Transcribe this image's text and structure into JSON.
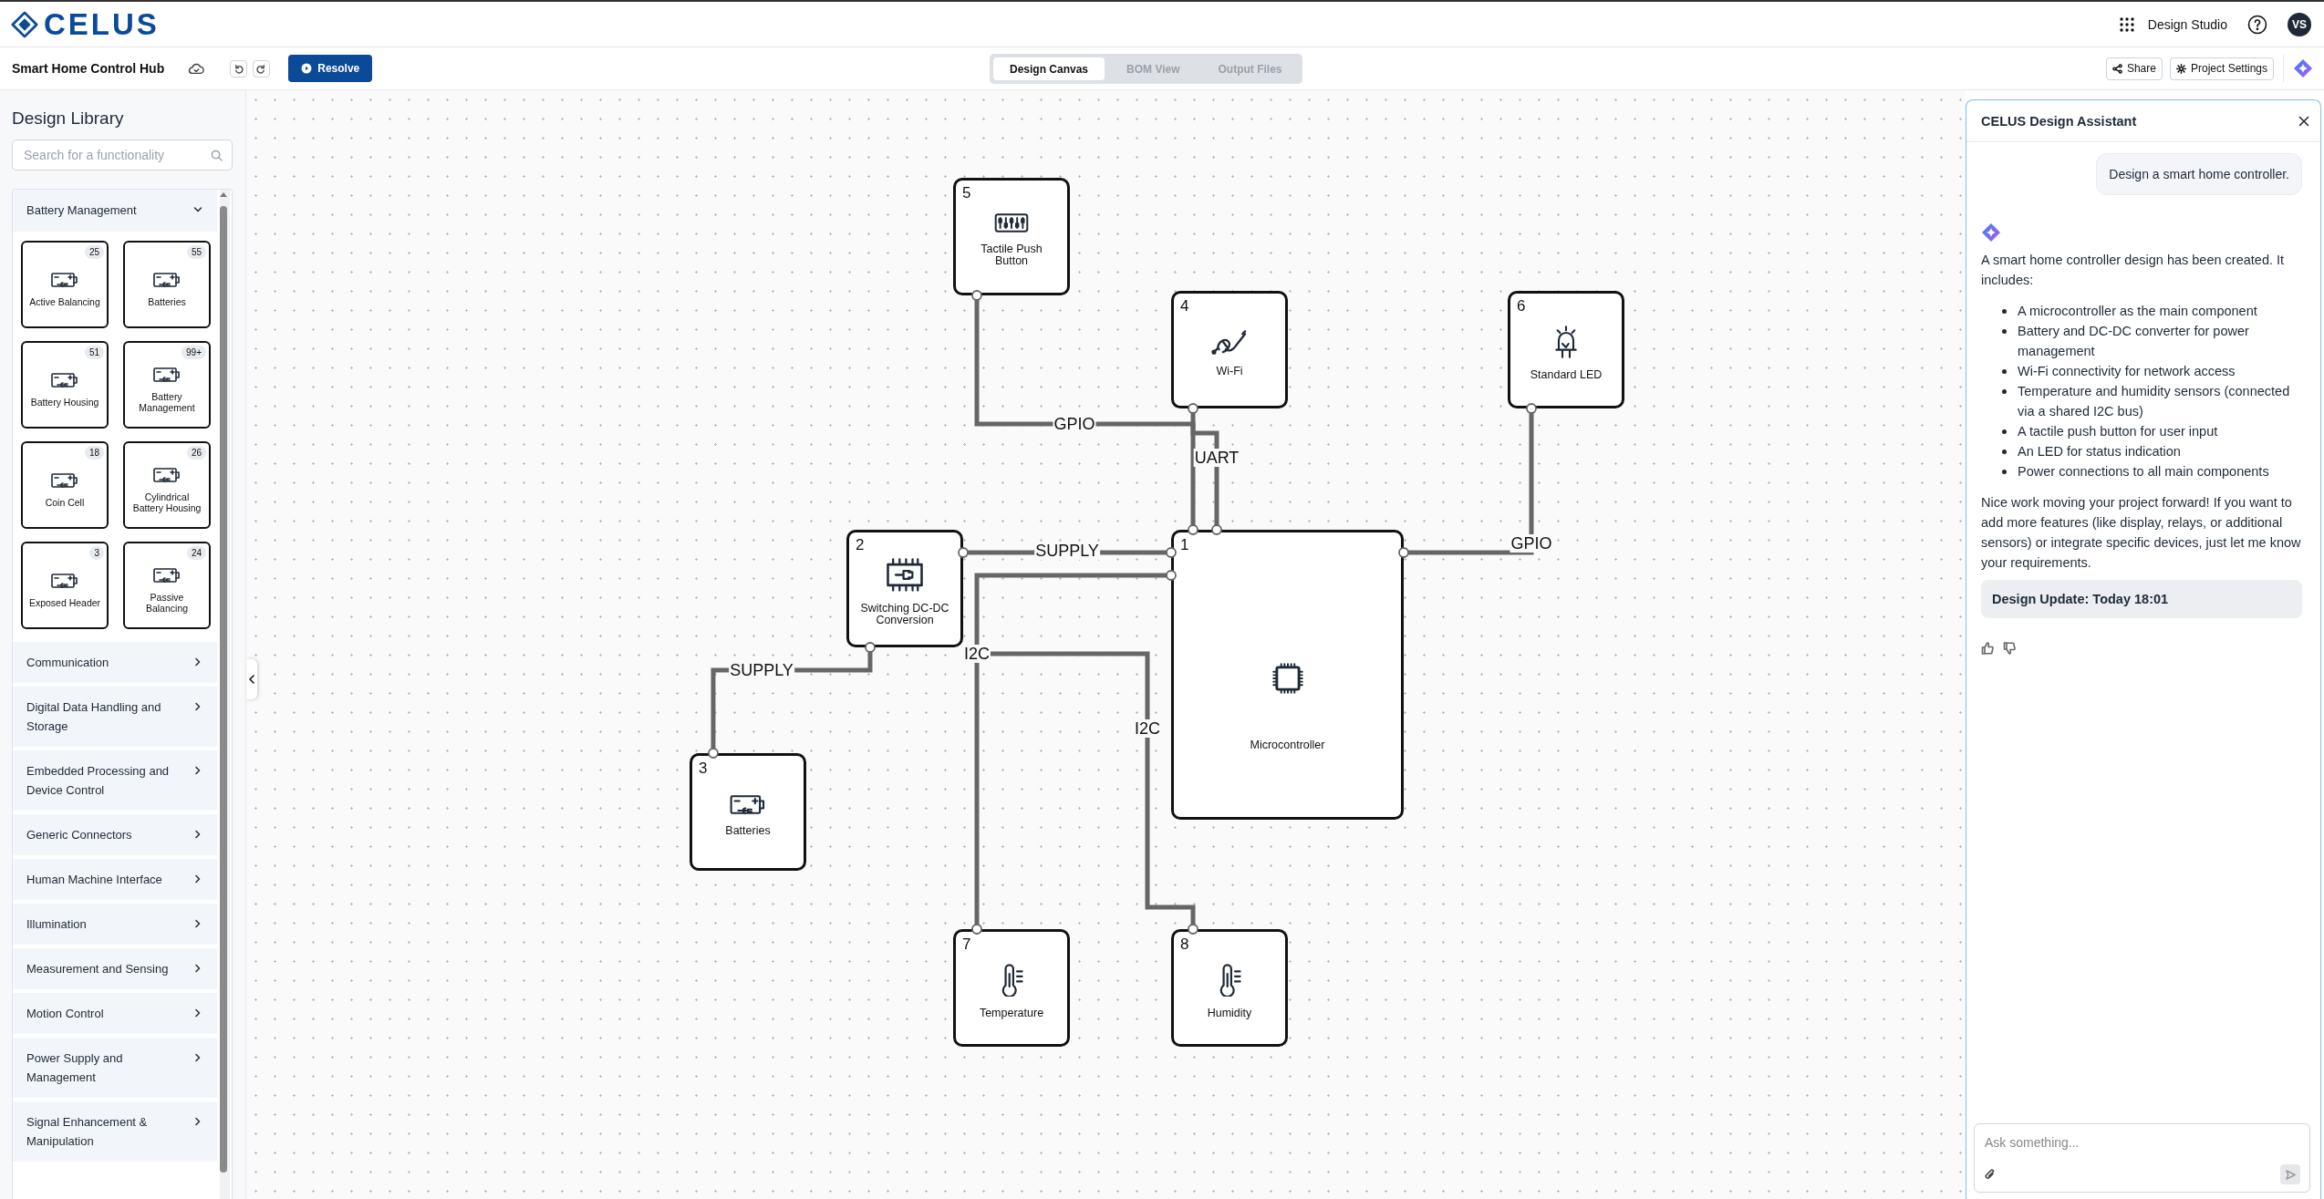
{
  "app": {
    "logo": "CELUS",
    "workspace": "Design Studio",
    "avatar": "VS"
  },
  "toolbar": {
    "project_title": "Smart Home Control Hub",
    "resolve_button": "Resolve",
    "view_tabs": [
      {
        "label": "Design Canvas",
        "selected": true
      },
      {
        "label": "BOM View",
        "selected": false
      },
      {
        "label": "Output Files",
        "selected": false
      }
    ],
    "share_button": "Share",
    "settings_button": "Project Settings"
  },
  "library": {
    "title": "Design Library",
    "search": {
      "placeholder": "Search for a functionality"
    },
    "categories": [
      {
        "name": "Battery Management",
        "expanded": true,
        "items": [
          {
            "label": "Active Balancing",
            "count": "25"
          },
          {
            "label": "Batteries",
            "count": "55"
          },
          {
            "label": "Battery Housing",
            "count": "51"
          },
          {
            "label": "Battery Management",
            "count": "99+"
          },
          {
            "label": "Coin Cell",
            "count": "18"
          },
          {
            "label": "Cylindrical Battery Housing",
            "count": "26"
          },
          {
            "label": "Exposed Header",
            "count": "3"
          },
          {
            "label": "Passive Balancing",
            "count": "24"
          }
        ]
      },
      {
        "name": "Communication",
        "expanded": false
      },
      {
        "name": "Digital Data Handling and Storage",
        "expanded": false
      },
      {
        "name": "Embedded Processing and Device Control",
        "expanded": false
      },
      {
        "name": "Generic Connectors",
        "expanded": false
      },
      {
        "name": "Human Machine Interface",
        "expanded": false
      },
      {
        "name": "Illumination",
        "expanded": false
      },
      {
        "name": "Measurement and Sensing",
        "expanded": false
      },
      {
        "name": "Motion Control",
        "expanded": false
      },
      {
        "name": "Power Supply and Management",
        "expanded": false
      },
      {
        "name": "Signal Enhancement & Manipulation",
        "expanded": false
      }
    ]
  },
  "canvas": {
    "blocks": [
      {
        "number": "5",
        "label": "Tactile Push Button"
      },
      {
        "number": "4",
        "label": "Wi-Fi"
      },
      {
        "number": "6",
        "label": "Standard LED"
      },
      {
        "number": "2",
        "label": "Switching DC-DC Conversion"
      },
      {
        "number": "1",
        "label": "Microcontroller"
      },
      {
        "number": "3",
        "label": "Batteries"
      },
      {
        "number": "7",
        "label": "Temperature"
      },
      {
        "number": "8",
        "label": "Humidity"
      }
    ],
    "connections": [
      {
        "label": "GPIO"
      },
      {
        "label": "UART"
      },
      {
        "label": "SUPPLY"
      },
      {
        "label": "GPIO"
      },
      {
        "label": "SUPPLY"
      },
      {
        "label": "I2C"
      },
      {
        "label": "I2C"
      }
    ]
  },
  "assistant": {
    "title": "CELUS Design Assistant",
    "messages": [
      {
        "kind": "user",
        "text": "Design a smart home controller."
      },
      {
        "kind": "assistant",
        "text": "A smart home controller design has been created. It includes:",
        "bullets": [
          "A microcontroller as the main component",
          "Battery and DC-DC converter for power management",
          "Wi-Fi connectivity for network access",
          "Temperature and humidity sensors (connected via a shared I2C bus)",
          "A tactile push button for user input",
          "An LED for status indication",
          "Power connections to all main components"
        ],
        "closing": "Nice work moving your project forward! If you want to add more features (like display, relays, or additional sensors) or integrate specific devices, just let me know your requirements.",
        "update": "Design Update: Today 18:01"
      }
    ],
    "input": {
      "placeholder": "Ask something..."
    }
  }
}
